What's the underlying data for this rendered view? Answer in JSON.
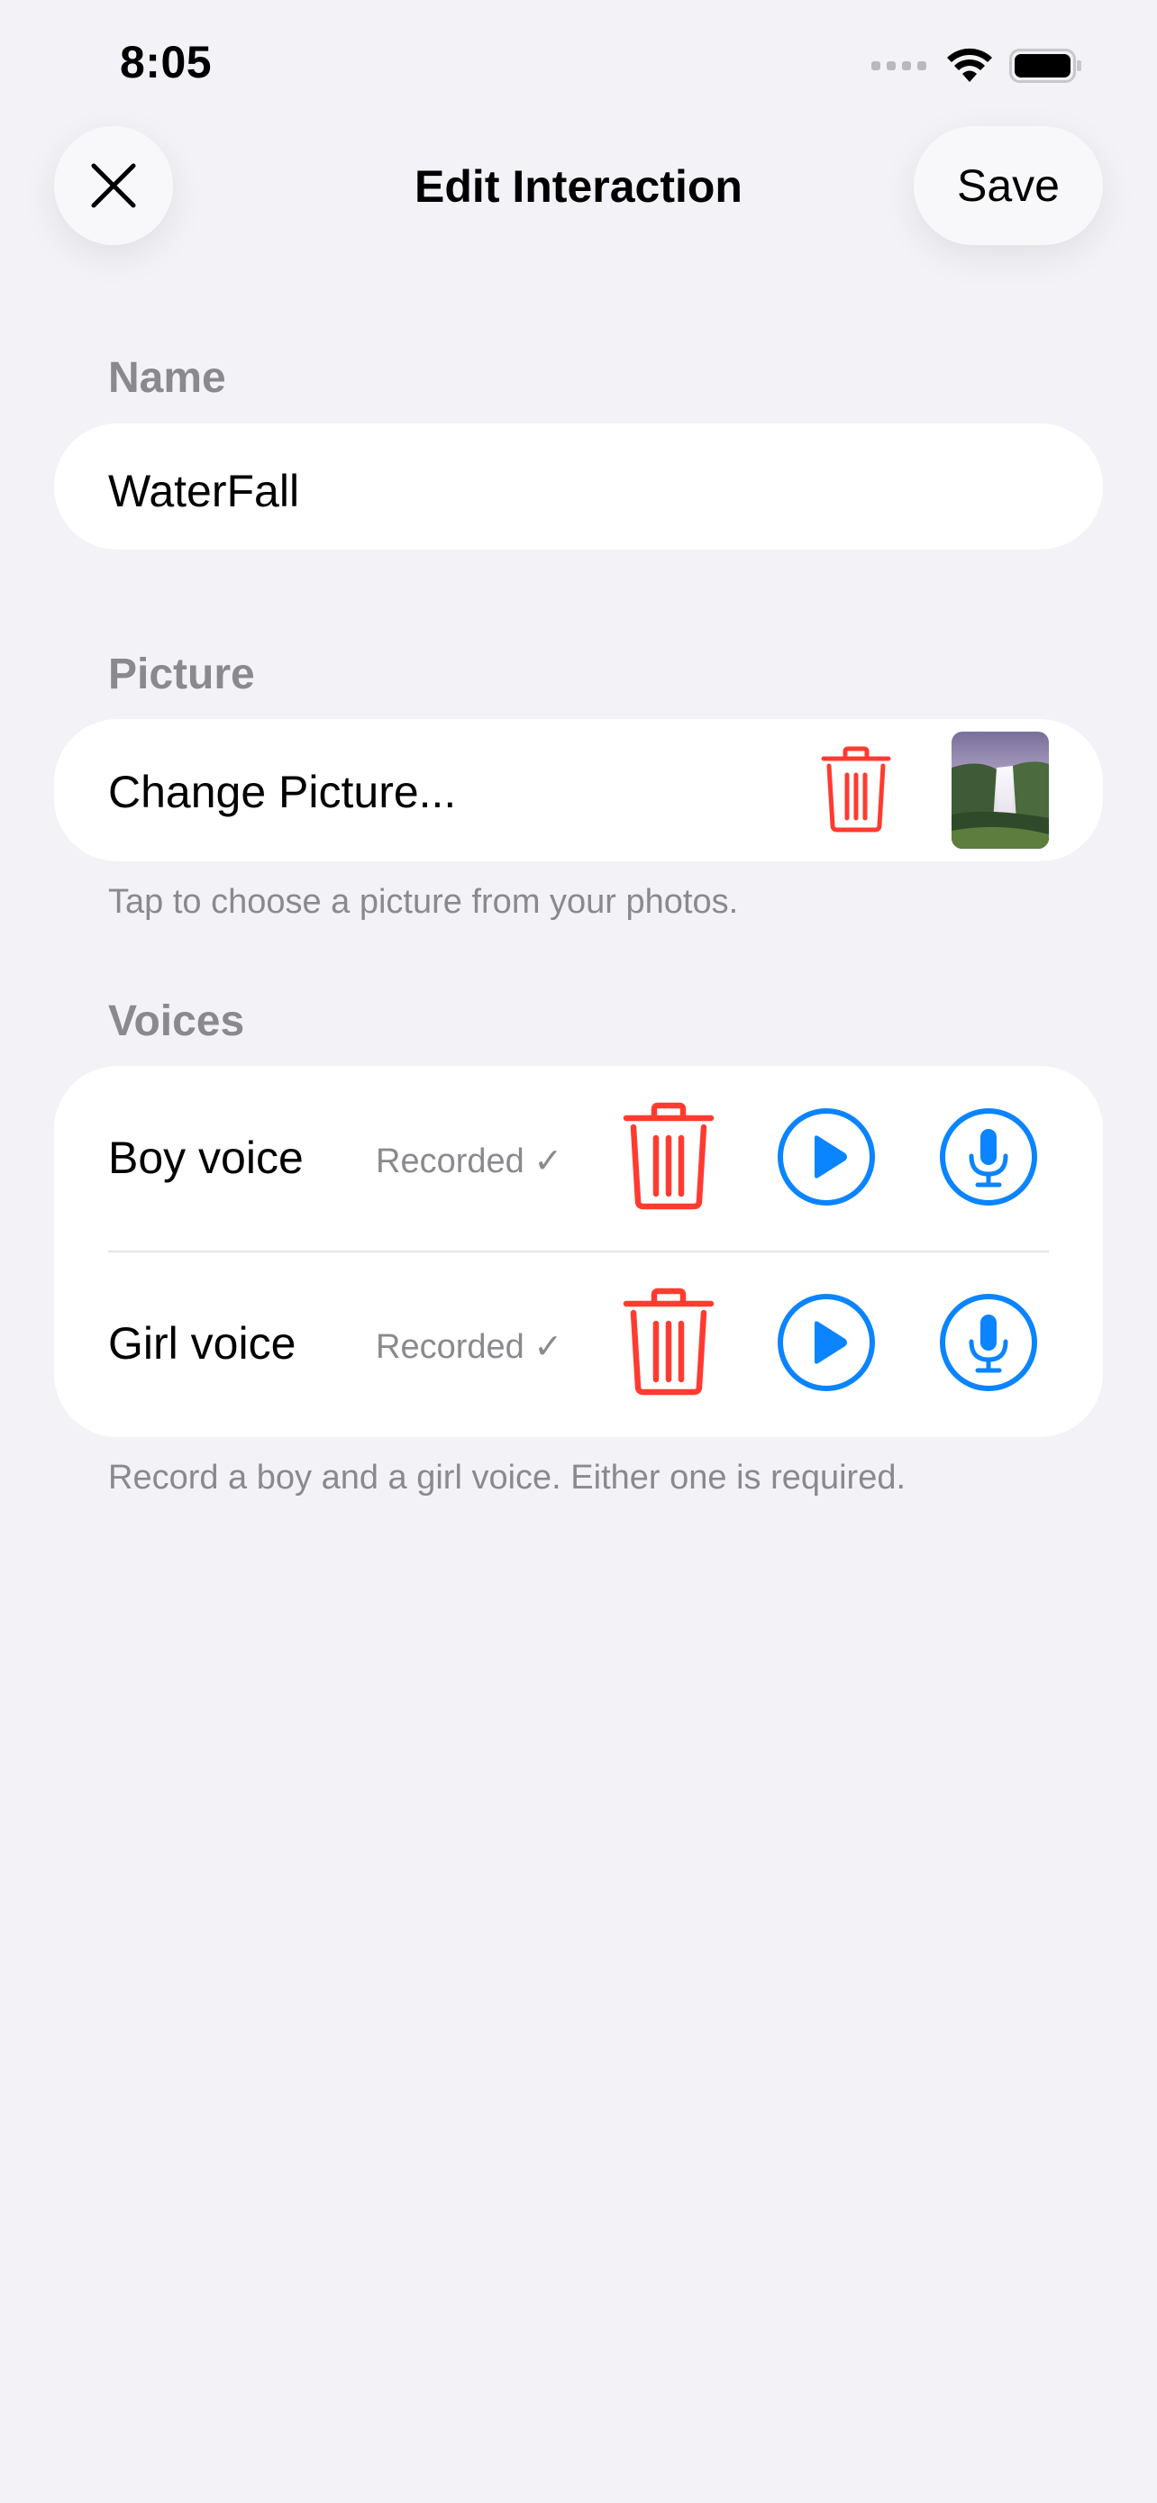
{
  "status_bar": {
    "time": "8:05"
  },
  "nav": {
    "title": "Edit Interaction",
    "save_label": "Save",
    "close_icon": "xmark-icon"
  },
  "name_section": {
    "label": "Name",
    "value": "WaterFall"
  },
  "picture_section": {
    "label": "Picture",
    "change_label": "Change Picture...",
    "footnote": "Tap to choose a picture from your photos."
  },
  "voices_section": {
    "label": "Voices",
    "items": [
      {
        "name": "Boy voice",
        "status": "Recorded ✓"
      },
      {
        "name": "Girl voice",
        "status": "Recorded ✓"
      }
    ],
    "footnote": "Record a boy and a girl voice. Either one is required."
  },
  "colors": {
    "background": "#f2f2f7",
    "destructive": "#ff3b30",
    "accent": "#0a84ff",
    "secondary_text": "#8a8a8e"
  }
}
